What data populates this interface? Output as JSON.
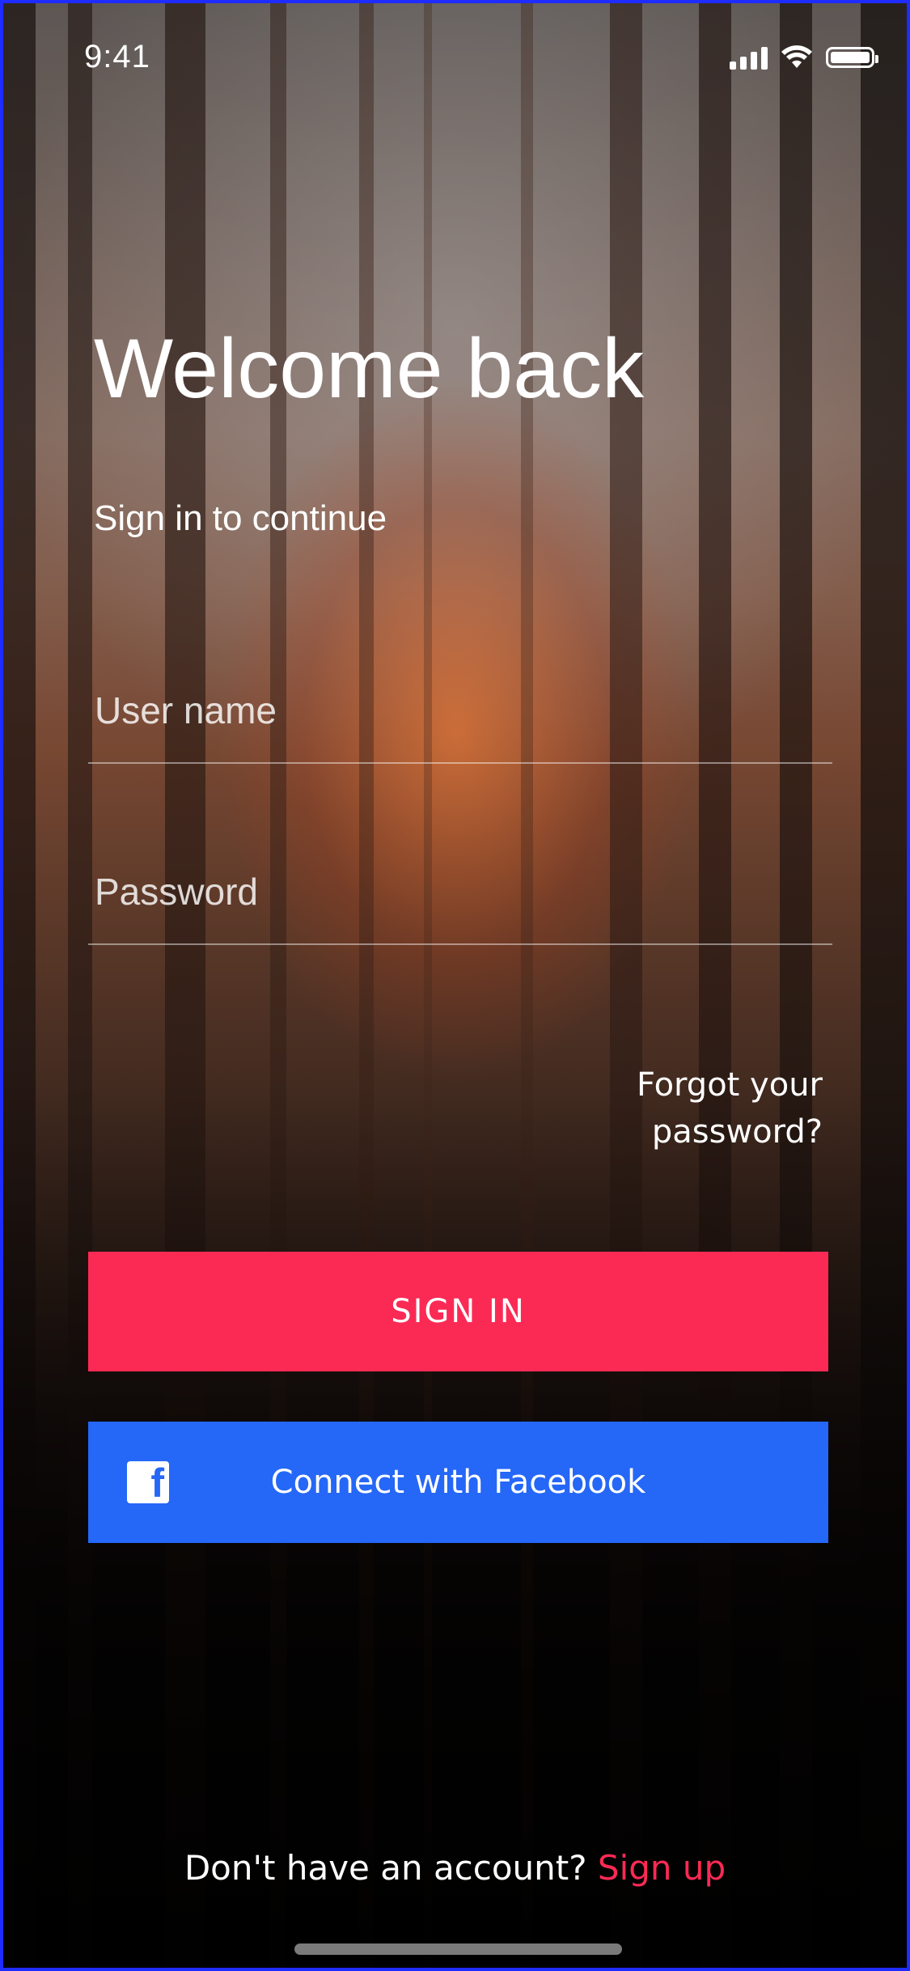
{
  "status_bar": {
    "time": "9:41",
    "icons": [
      "signal-icon",
      "wifi-icon",
      "battery-icon"
    ]
  },
  "login": {
    "title": "Welcome back",
    "subtitle": "Sign in to continue",
    "username": {
      "placeholder": "User name",
      "value": ""
    },
    "password": {
      "placeholder": "Password",
      "value": ""
    },
    "forgot_password": "Forgot your password?",
    "sign_in_label": "SIGN IN",
    "facebook_label": "Connect with Facebook"
  },
  "footer": {
    "prompt": "Don't have an account? ",
    "signup_label": "Sign up"
  },
  "colors": {
    "accent": "#fb2a55",
    "facebook": "#2567f7",
    "text": "#ffffff"
  }
}
